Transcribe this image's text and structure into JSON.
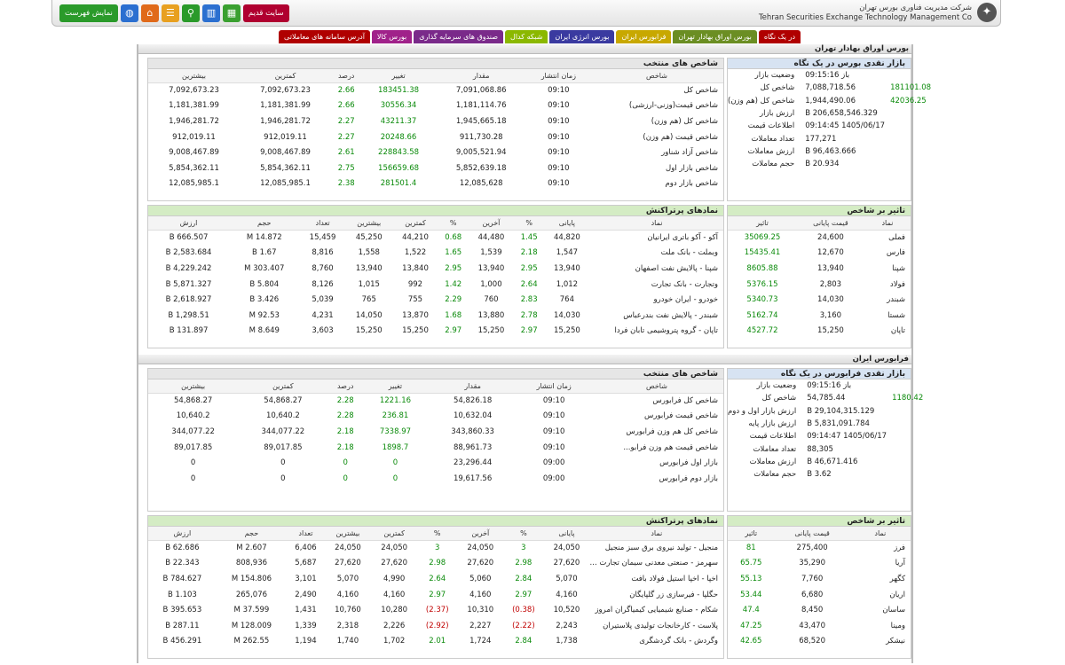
{
  "header": {
    "company_fa": "شرکت مدیریت فناوری بورس تهران",
    "company_en": "Tehran Securities Exchange Technology Management Co",
    "old_site": "سایت قدیم",
    "show_list": "نمایش فهرست"
  },
  "tabs": [
    {
      "label": "در یک نگاه",
      "color": "#b00000"
    },
    {
      "label": "بورس اوراق بهادار تهران",
      "color": "#6b8e23"
    },
    {
      "label": "فرابورس ایران",
      "color": "#c8a800"
    },
    {
      "label": "بورس انرژی ایران",
      "color": "#3a3aa0"
    },
    {
      "label": "شبکه کدال",
      "color": "#8bb800"
    },
    {
      "label": "صندوق های سرمایه گذاری",
      "color": "#7a2a8a"
    },
    {
      "label": "بورس کالا",
      "color": "#a0228a"
    },
    {
      "label": "آدرس سامانه های معاملاتی",
      "color": "#b00000"
    }
  ],
  "tse": {
    "section_title": "بورس اوراق بهادار تهران",
    "market_title": "بازار نقدی بورس در یک نگاه",
    "market": [
      {
        "k": "وضعیت بازار",
        "v": "باز 09:15:16",
        "hl": ""
      },
      {
        "k": "شاخص کل",
        "v": "7,088,718.56",
        "hl": "181101.08"
      },
      {
        "k": "شاخص کل (هم وزن)",
        "v": "1,944,490.06",
        "hl": "42036.25"
      },
      {
        "k": "ارزش بازار",
        "v": "206,658,546.329 B",
        "hl": ""
      },
      {
        "k": "اطلاعات قیمت",
        "v": "1405/06/17 09:14:45",
        "hl": ""
      },
      {
        "k": "تعداد معاملات",
        "v": "177,271",
        "hl": ""
      },
      {
        "k": "ارزش معاملات",
        "v": "96,463.666 B",
        "hl": ""
      },
      {
        "k": "حجم معاملات",
        "v": "20.934 B",
        "hl": ""
      }
    ],
    "indices_title": "شاخص های منتخب",
    "indices_cols": [
      "شاخص",
      "زمان انتشار",
      "مقدار",
      "تغییر",
      "درصد",
      "کمترین",
      "بیشترین"
    ],
    "indices": [
      [
        "شاخص کل",
        "09:10",
        "7,091,068.86",
        "183451.38",
        "2.66",
        "7,092,673.23",
        "7,092,673.23"
      ],
      [
        "شاخص قیمت(وزنی-ارزشی)",
        "09:10",
        "1,181,114.76",
        "30556.34",
        "2.66",
        "1,181,381.99",
        "1,181,381.99"
      ],
      [
        "شاخص کل (هم وزن)",
        "09:10",
        "1,945,665.18",
        "43211.37",
        "2.27",
        "1,946,281.72",
        "1,946,281.72"
      ],
      [
        "شاخص قیمت (هم وزن)",
        "09:10",
        "911,730.28",
        "20248.66",
        "2.27",
        "912,019.11",
        "912,019.11"
      ],
      [
        "شاخص آزاد شناور",
        "09:10",
        "9,005,521.94",
        "228843.58",
        "2.61",
        "9,008,467.89",
        "9,008,467.89"
      ],
      [
        "شاخص بازار اول",
        "09:10",
        "5,852,639.18",
        "156659.68",
        "2.75",
        "5,854,362.11",
        "5,854,362.11"
      ],
      [
        "شاخص بازار دوم",
        "09:10",
        "12,085,628",
        "281501.4",
        "2.38",
        "12,085,985.1",
        "12,085,985.1"
      ]
    ],
    "effect_title": "تاثیر بر شاخص",
    "effect_cols": [
      "نماد",
      "قیمت پایانی",
      "تاثیر"
    ],
    "effect": [
      [
        "فملی",
        "24,600",
        "35069.25"
      ],
      [
        "فارس",
        "12,670",
        "15435.41"
      ],
      [
        "شپنا",
        "13,940",
        "8605.88"
      ],
      [
        "فولاد",
        "2,803",
        "5376.15"
      ],
      [
        "شبندر",
        "14,030",
        "5340.73"
      ],
      [
        "شستا",
        "3,160",
        "5162.74"
      ],
      [
        "تاپان",
        "15,250",
        "4527.72"
      ]
    ],
    "active_title": "نمادهای پرتراکنش",
    "active_cols": [
      "نماد",
      "پایانی",
      "%",
      "آخرین",
      "%",
      "کمترین",
      "بیشترین",
      "تعداد",
      "حجم",
      "ارزش"
    ],
    "active": [
      [
        "آکو - آکو باتری ایرانیان",
        "44,820",
        "1.45",
        "44,480",
        "0.68",
        "44,210",
        "45,250",
        "15,459",
        "14.872 M",
        "666.507 B"
      ],
      [
        "وبملت - بانک ملت",
        "1,547",
        "2.18",
        "1,539",
        "1.65",
        "1,522",
        "1,558",
        "8,816",
        "1.67 B",
        "2,583.684 B"
      ],
      [
        "شپنا - پالایش نفت اصفهان",
        "13,940",
        "2.95",
        "13,940",
        "2.95",
        "13,840",
        "13,940",
        "8,760",
        "303.407 M",
        "4,229.242 B"
      ],
      [
        "وتجارت - بانک تجارت",
        "1,012",
        "2.64",
        "1,000",
        "1.42",
        "992",
        "1,015",
        "8,126",
        "5.804 B",
        "5,871.327 B"
      ],
      [
        "خودرو - ایران خودرو",
        "764",
        "2.83",
        "760",
        "2.29",
        "755",
        "765",
        "5,039",
        "3.426 B",
        "2,618.927 B"
      ],
      [
        "شبندر - پالایش نفت بندرعباس",
        "14,030",
        "2.78",
        "13,880",
        "1.68",
        "13,870",
        "14,050",
        "4,231",
        "92.53 M",
        "1,298.51 B"
      ],
      [
        "تاپان - گروه پتروشیمی تابان فردا",
        "15,250",
        "2.97",
        "15,250",
        "2.97",
        "15,250",
        "15,250",
        "3,603",
        "8.649 M",
        "131.897 B"
      ]
    ]
  },
  "ifb": {
    "section_title": "فرابورس ایران",
    "market_title": "بازار نقدی فرابورس در یک نگاه",
    "market": [
      {
        "k": "وضعیت بازار",
        "v": "باز 09:15:16",
        "hl": ""
      },
      {
        "k": "شاخص کل",
        "v": "54,785.44",
        "hl": "1180.42"
      },
      {
        "k": "ارزش بازار اول و دوم",
        "v": "29,104,315.129 B",
        "hl": ""
      },
      {
        "k": "ارزش بازار پایه",
        "v": "5,831,091.784 B",
        "hl": ""
      },
      {
        "k": "اطلاعات قیمت",
        "v": "1405/06/17 09:14:47",
        "hl": ""
      },
      {
        "k": "تعداد معاملات",
        "v": "88,305",
        "hl": ""
      },
      {
        "k": "ارزش معاملات",
        "v": "46,671.416 B",
        "hl": ""
      },
      {
        "k": "حجم معاملات",
        "v": "3.62 B",
        "hl": ""
      }
    ],
    "indices_title": "شاخص های منتخب",
    "indices_cols": [
      "شاخص",
      "زمان انتشار",
      "مقدار",
      "تغییر",
      "درصد",
      "کمترین",
      "بیشترین"
    ],
    "indices": [
      [
        "شاخص کل فرابورس",
        "09:10",
        "54,826.18",
        "1221.16",
        "2.28",
        "54,868.27",
        "54,868.27"
      ],
      [
        "شاخص قیمت فرابورس",
        "09:10",
        "10,632.04",
        "236.81",
        "2.28",
        "10,640.2",
        "10,640.2"
      ],
      [
        "شاخص کل هم وزن فرابورس",
        "09:10",
        "343,860.33",
        "7338.97",
        "2.18",
        "344,077.22",
        "344,077.22"
      ],
      [
        "شاخص قیمت هم وزن فرابو...",
        "09:10",
        "88,961.73",
        "1898.7",
        "2.18",
        "89,017.85",
        "89,017.85"
      ],
      [
        "بازار اول فرابورس",
        "09:00",
        "23,296.44",
        "0",
        "0",
        "0",
        "0"
      ],
      [
        "بازار دوم فرابورس",
        "09:00",
        "19,617.56",
        "0",
        "0",
        "0",
        "0"
      ]
    ],
    "effect_title": "تاثیر بر شاخص",
    "effect_cols": [
      "نماد",
      "قیمت پایانی",
      "تاثیر"
    ],
    "effect": [
      [
        "فرز",
        "275,400",
        "81"
      ],
      [
        "آریا",
        "35,290",
        "65.75"
      ],
      [
        "کگهر",
        "7,760",
        "55.13"
      ],
      [
        "اریان",
        "6,680",
        "53.44"
      ],
      [
        "ساسان",
        "8,450",
        "47.4"
      ],
      [
        "ومینا",
        "43,470",
        "47.25"
      ],
      [
        "نیشکر",
        "68,520",
        "42.65"
      ]
    ],
    "active_title": "نمادهای پرتراکنش",
    "active_cols": [
      "نماد",
      "پایانی",
      "%",
      "آخرین",
      "%",
      "کمترین",
      "بیشترین",
      "تعداد",
      "حجم",
      "ارزش"
    ],
    "active": [
      [
        "منجیل - تولید نیروی برق سبز منجیل",
        "24,050",
        "3",
        "24,050",
        "3",
        "24,050",
        "24,050",
        "6,406",
        "2.607 M",
        "62.686 B"
      ],
      [
        "سهرمز - صنعتی معدنی سیمان تجارت ...",
        "27,620",
        "2.98",
        "27,620",
        "2.98",
        "27,620",
        "27,620",
        "5,687",
        "808,936",
        "22.343 B"
      ],
      [
        "اخپا - اخپا استیل فولاد بافت",
        "5,070",
        "2.84",
        "5,060",
        "2.64",
        "4,990",
        "5,070",
        "3,101",
        "154.806 M",
        "784.627 B"
      ],
      [
        "حگلپا - فیرسازی زر گلپایگان",
        "4,160",
        "2.97",
        "4,160",
        "2.97",
        "4,160",
        "4,160",
        "2,490",
        "265,076",
        "1.103 B"
      ],
      [
        "شکام - صنایع شیمیایی کیمیاگران امروز",
        "10,520",
        "(0.38)",
        "10,310",
        "(2.37)",
        "10,280",
        "10,760",
        "1,431",
        "37.599 M",
        "395.653 B"
      ],
      [
        "پلاست - کارخانجات تولیدی پلاستیران",
        "2,243",
        "(2.22)",
        "2,227",
        "(2.92)",
        "2,226",
        "2,318",
        "1,339",
        "128.009 M",
        "287.11 B"
      ],
      [
        "وگردش - بانک گردشگری",
        "1,738",
        "2.84",
        "1,724",
        "2.01",
        "1,702",
        "1,740",
        "1,194",
        "262.55 M",
        "456.291 B"
      ]
    ]
  }
}
